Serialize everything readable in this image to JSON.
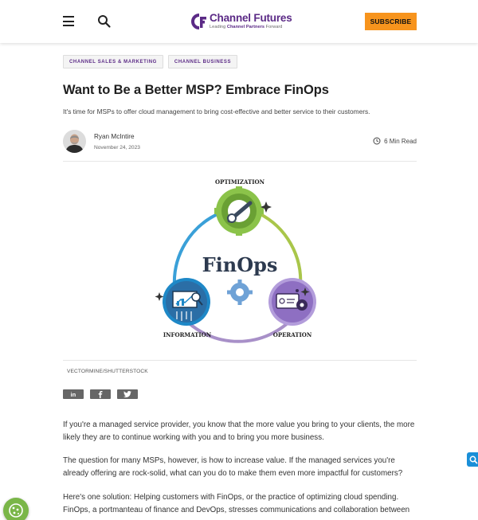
{
  "header": {
    "logo_name": "Channel Futures",
    "logo_tag_prefix": "Leading ",
    "logo_tag_bold": "Channel Partners",
    "logo_tag_suffix": " Forward",
    "subscribe_label": "SUBSCRIBE",
    "colors": {
      "brand": "#5b2a86",
      "subscribe": "#f7941d"
    }
  },
  "tags": [
    "CHANNEL SALES & MARKETING",
    "CHANNEL BUSINESS"
  ],
  "article": {
    "title": "Want to Be a Better MSP? Embrace FinOps",
    "dek": "It's time for MSPs to offer cloud management to bring cost-effective and better service to their customers.",
    "author": "Ryan McIntire",
    "date": "November 24, 2023",
    "read_time": "6 Min Read",
    "image_credit": "VECTORMINE/SHUTTERSTOCK",
    "paragraphs": [
      "If you're a managed service provider, you know that the more value you bring to your clients, the more likely they are to continue working with you and to bring you more business.",
      "The question for many MSPs, however, is how to increase value. If the managed services you're already offering are rock-solid, what can you do to make them even more impactful for customers?",
      "Here's one solution: Helping customers with FinOps, or the practice of optimizing cloud spending. FinOps, a portmanteau of finance and DevOps, stresses communications and collaboration between"
    ]
  },
  "illustration": {
    "center_label": "FinOps",
    "top_label": "OPTIMIZATION",
    "left_label": "INFORMATION",
    "right_label": "OPERATION"
  },
  "share": [
    "linkedin-icon",
    "facebook-icon",
    "twitter-icon"
  ]
}
